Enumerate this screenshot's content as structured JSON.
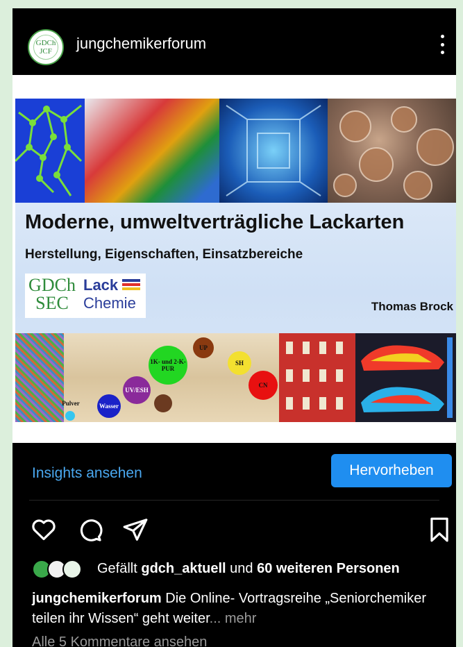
{
  "header": {
    "avatar_line1": "GDCh",
    "avatar_line2": "JCF",
    "username": "jungchemikerforum"
  },
  "slide": {
    "title": "Moderne, umweltverträgliche Lackarten",
    "subtitle": "Herstellung, Eigenschaften, Einsatzbereiche",
    "logo_gdch_line1": "GDCh",
    "logo_gdch_line2": "SEC",
    "logo_lack_line1": "Lack",
    "logo_lack_line2": "Chemie",
    "author": "Thomas Brock",
    "bubbles": [
      "1K- und 2-K-PUR",
      "UP",
      "SH",
      "UV/ESH",
      "CN",
      "Wasser",
      "Pulver"
    ]
  },
  "actions": {
    "insights_label": "Insights ansehen",
    "highlight_label": "Hervorheben"
  },
  "likes": {
    "prefix": "Gefällt ",
    "user": "gdch_aktuell",
    "middle": " und ",
    "count": "60 weiteren Personen"
  },
  "caption": {
    "user": "jungchemikerforum",
    "text": " Die Online- Vortragsreihe „Seniorchemiker teilen ihr Wissen“ geht weiter",
    "more": "... mehr"
  },
  "comments_label": "Alle 5 Kommentare ansehen",
  "colors": {
    "background": "#000000",
    "accent_link": "#4aa8f0",
    "button": "#1f8ef0",
    "page_margin": "#dcefdc"
  },
  "icons": [
    "heart-icon",
    "comment-icon",
    "share-icon",
    "bookmark-icon",
    "more-options-icon"
  ]
}
